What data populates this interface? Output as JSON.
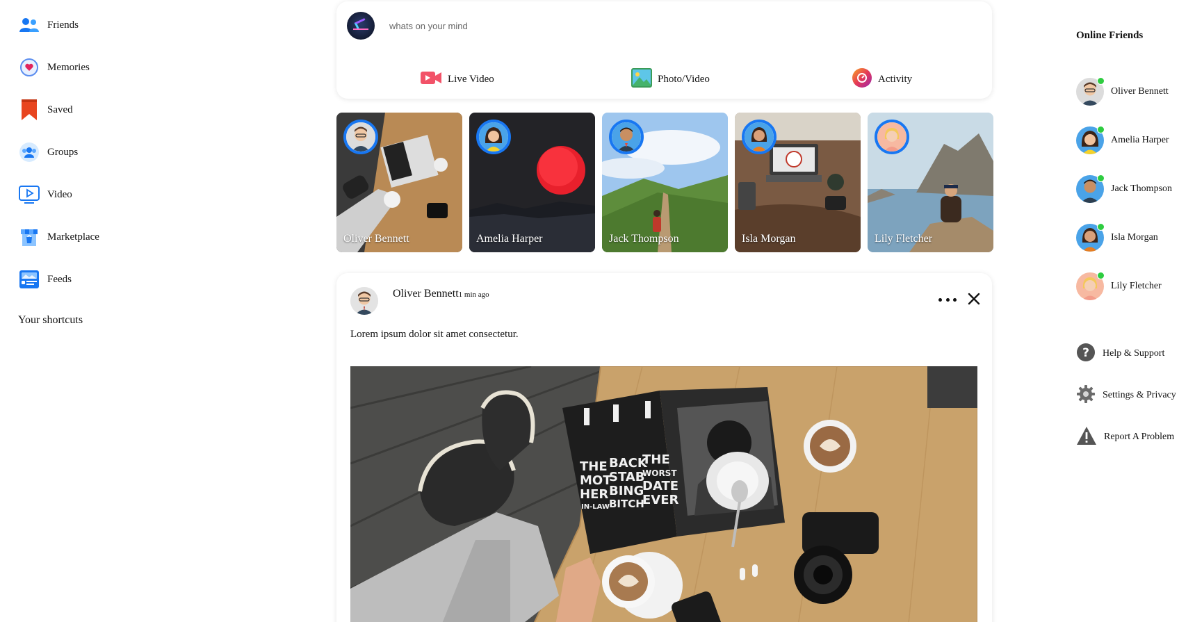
{
  "sidebar": {
    "items": [
      {
        "label": "Friends",
        "icon": "friends-icon"
      },
      {
        "label": "Memories",
        "icon": "memories-icon"
      },
      {
        "label": "Saved",
        "icon": "saved-bookmark-icon"
      },
      {
        "label": "Groups",
        "icon": "groups-icon"
      },
      {
        "label": "Video",
        "icon": "video-play-icon"
      },
      {
        "label": "Marketplace",
        "icon": "marketplace-shop-icon"
      },
      {
        "label": "Feeds",
        "icon": "feeds-icon"
      }
    ],
    "shortcuts_title": "Your shortcuts"
  },
  "composer": {
    "placeholder": "whats on your mind",
    "actions": [
      {
        "label": "Live Video",
        "icon": "live-video-icon"
      },
      {
        "label": "Photo/Video",
        "icon": "photo-video-icon"
      },
      {
        "label": "Activity",
        "icon": "activity-icon"
      }
    ]
  },
  "stories": [
    {
      "name": "Oliver Bennett"
    },
    {
      "name": "Amelia Harper"
    },
    {
      "name": "Jack Thompson"
    },
    {
      "name": "Isla Morgan"
    },
    {
      "name": "Lily Fletcher"
    }
  ],
  "post": {
    "author": "Oliver Bennett",
    "time": "1 min ago",
    "text": "Lorem ipsum dolor sit amet consectetur.",
    "magazine_text": [
      "THE",
      "MOT",
      "HER",
      "IN-LAW",
      "BACK",
      "STAB",
      "BING",
      "BITCH",
      "THE",
      "WORST",
      "DATE",
      "EVER"
    ]
  },
  "online_friends": {
    "title": "Online Friends",
    "items": [
      {
        "name": "Oliver Bennett"
      },
      {
        "name": "Amelia Harper"
      },
      {
        "name": "Jack Thompson"
      },
      {
        "name": "Isla Morgan"
      },
      {
        "name": "Lily Fletcher"
      }
    ]
  },
  "utilities": [
    {
      "label": "Help & Support",
      "icon": "help-icon"
    },
    {
      "label": "Settings & Privacy",
      "icon": "settings-gear-icon"
    },
    {
      "label": "Report A Problem",
      "icon": "warning-icon"
    }
  ],
  "colors": {
    "accent": "#1877f2",
    "online": "#2ecc40",
    "saved": "#e8451f"
  }
}
